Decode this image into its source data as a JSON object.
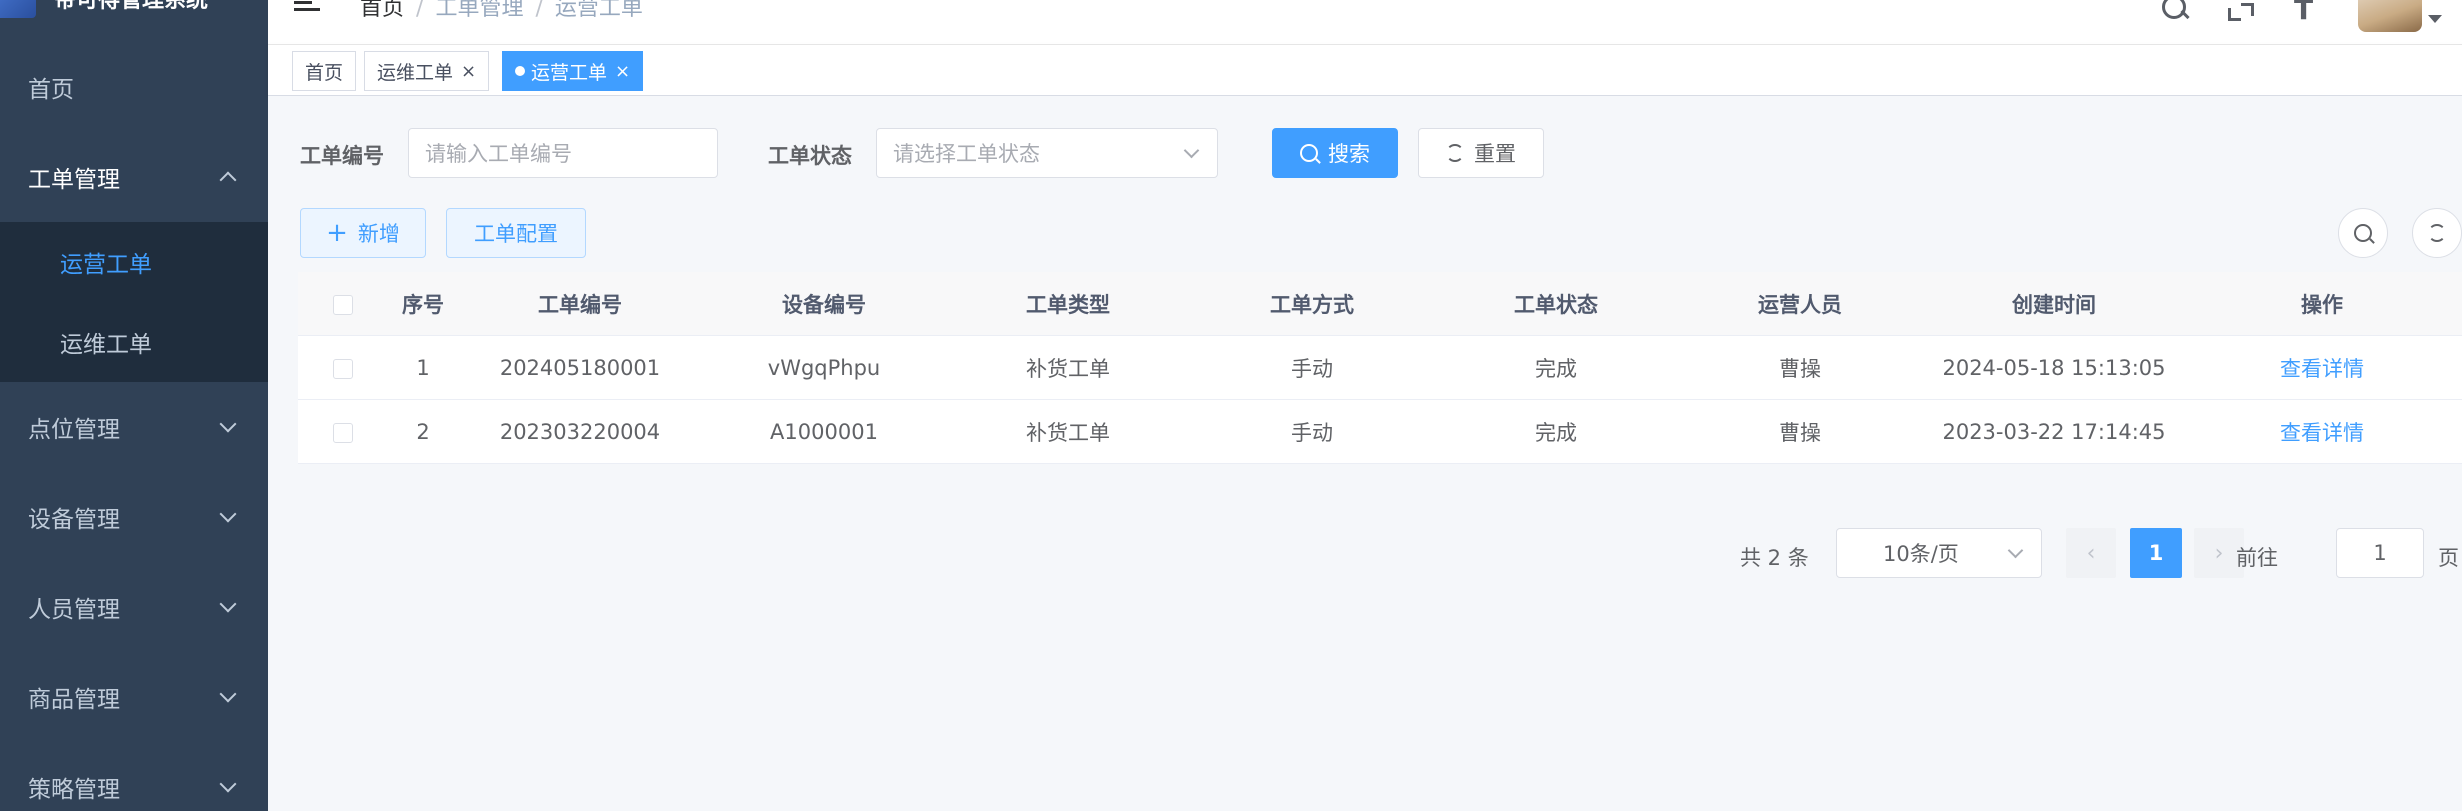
{
  "sidebar": {
    "logo_text": "帝可得管理系统",
    "menu": [
      {
        "label": "首页"
      },
      {
        "label": "工单管理",
        "open": true,
        "children": [
          {
            "label": "运营工单",
            "active": true
          },
          {
            "label": "运维工单"
          }
        ]
      },
      {
        "label": "点位管理"
      },
      {
        "label": "设备管理"
      },
      {
        "label": "人员管理"
      },
      {
        "label": "商品管理"
      },
      {
        "label": "策略管理"
      }
    ]
  },
  "breadcrumb": [
    "首页",
    "工单管理",
    "运营工单"
  ],
  "breadcrumb_sep": "/",
  "tags": [
    {
      "label": "首页"
    },
    {
      "label": "运维工单",
      "close": "×"
    },
    {
      "label": "运营工单",
      "close": "×",
      "active": true
    }
  ],
  "filters": {
    "order_no_label": "工单编号",
    "order_no_placeholder": "请输入工单编号",
    "status_label": "工单状态",
    "status_placeholder": "请选择工单状态",
    "search_label": "搜索",
    "reset_label": "重置"
  },
  "toolbar": {
    "add_icon": "+",
    "add_label": "新增",
    "config_label": "工单配置"
  },
  "table": {
    "columns": [
      "序号",
      "工单编号",
      "设备编号",
      "工单类型",
      "工单方式",
      "工单状态",
      "运营人员",
      "创建时间",
      "操作"
    ],
    "rows": [
      {
        "index": "1",
        "order_no": "202405180001",
        "device_no": "vWgqPhpu",
        "type": "补货工单",
        "method": "手动",
        "status": "完成",
        "operator": "曹操",
        "created": "2024-05-18 15:13:05",
        "action": "查看详情"
      },
      {
        "index": "2",
        "order_no": "202303220004",
        "device_no": "A1000001",
        "type": "补货工单",
        "method": "手动",
        "status": "完成",
        "operator": "曹操",
        "created": "2023-03-22 17:14:45",
        "action": "查看详情"
      }
    ]
  },
  "pagination": {
    "total": "共 2 条",
    "page_size": "10条/页",
    "prev": "‹",
    "next": "›",
    "current": "1",
    "goto_label": "前往",
    "goto_value": "1",
    "page_suffix": "页"
  },
  "colors": {
    "primary": "#409eff",
    "sidebar_bg": "#304156",
    "submenu_bg": "#1f2d3d"
  }
}
